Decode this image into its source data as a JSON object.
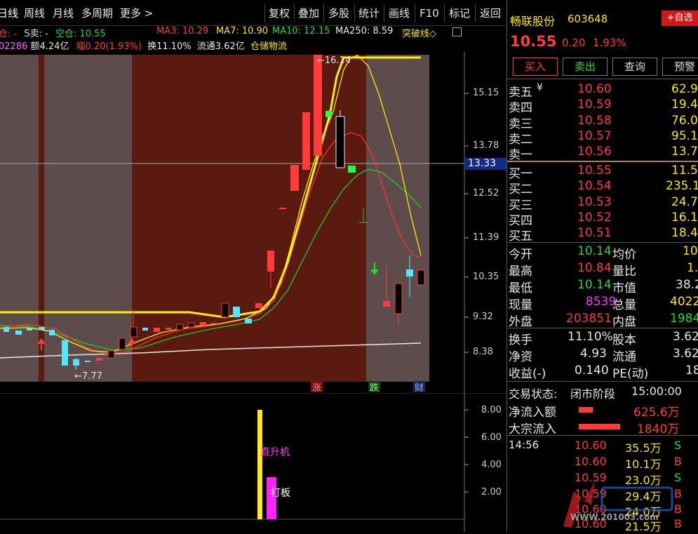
{
  "toolbar": {
    "left_tabs": [
      "日线",
      "周线",
      "月线",
      "多周期",
      "更多 >"
    ],
    "right_buttons": [
      "复权",
      "叠加",
      "多股",
      "统计",
      "画线",
      "F10",
      "标记",
      "返回"
    ]
  },
  "indicators": {
    "line1": {
      "prefix": "仓: -",
      "s_sell": "S卖: -",
      "empty_pos": "空仓: 10.55",
      "ma3": "MA3: 10.29",
      "ma7": "MA7: 10.90",
      "ma10": "MA10: 12.15",
      "ma250": "MA250: 8.59",
      "breakout": "突破线◇"
    },
    "line2": {
      "vol": "02286",
      "amount": "额4.24亿",
      "range": "幅0.20(1.93%)",
      "turnover": "换11.10%",
      "float": "流通3.62亿",
      "sector": "仓储物流"
    }
  },
  "chart": {
    "price_axis": [
      "15.15",
      "13.78",
      "12.52",
      "11.39",
      "10.35",
      "9.32",
      "8.38"
    ],
    "crosshair_value": "13.33",
    "high_label": "16.14",
    "low_label": "7.77",
    "event_markers": [
      "涨",
      "跌",
      "财"
    ],
    "sub_axis": [
      "8.00",
      "6.00",
      "4.00",
      "2.00"
    ],
    "sub_labels": [
      "直升机",
      "打板"
    ],
    "colors": {
      "up": "#ff3b3b",
      "down": "#55e6ff",
      "ma3": "#ffffff",
      "ma7": "#ffff00",
      "ma10": "#ff3333",
      "ma250": "#33cc33"
    }
  },
  "quote": {
    "name": "畅联股份",
    "code": "603648",
    "watch_btn": "+自选",
    "price": "10.55",
    "change": "0.20",
    "change_pct": "1.93%",
    "actions": [
      "买入",
      "卖出",
      "查询",
      "预警"
    ]
  },
  "order_book": {
    "asks": [
      {
        "label": "卖五",
        "price": "10.60",
        "vol": "62.9"
      },
      {
        "label": "卖四",
        "price": "10.59",
        "vol": "19.4"
      },
      {
        "label": "卖三",
        "price": "10.58",
        "vol": "76.0"
      },
      {
        "label": "卖二",
        "price": "10.57",
        "vol": "95.1"
      },
      {
        "label": "卖一",
        "price": "10.56",
        "vol": "13.7"
      }
    ],
    "bids": [
      {
        "label": "买一",
        "price": "10.55",
        "vol": "11.5"
      },
      {
        "label": "买二",
        "price": "10.54",
        "vol": "235.1"
      },
      {
        "label": "买三",
        "price": "10.53",
        "vol": "24.7"
      },
      {
        "label": "买四",
        "price": "10.52",
        "vol": "16.1"
      },
      {
        "label": "买五",
        "price": "10.51",
        "vol": "18.4"
      }
    ],
    "yen_mark": "¥"
  },
  "stats": [
    {
      "l1": "今开",
      "v1": "10.14",
      "l2": "均价",
      "v2": "10."
    },
    {
      "l1": "最高",
      "v1": "10.84",
      "l2": "量比",
      "v2": "1."
    },
    {
      "l1": "最低",
      "v1": "10.14",
      "l2": "市值",
      "v2": "38.2"
    },
    {
      "l1": "现量",
      "v1": "8539",
      "l2": "总量",
      "v2": "4022"
    },
    {
      "l1": "外盘",
      "v1": "203851",
      "l2": "内盘",
      "v2": "1984"
    }
  ],
  "fundamentals": [
    {
      "l1": "换手",
      "v1": "11.10%",
      "l2": "股本",
      "v2": "3.62"
    },
    {
      "l1": "净资",
      "v1": "4.93",
      "l2": "流通",
      "v2": "3.62"
    },
    {
      "l1": "收益(-)",
      "v1": "0.140",
      "l2": "PE(动)",
      "v2": "18"
    }
  ],
  "status": {
    "label": "交易状态:",
    "phase": "闭市阶段",
    "time": "15:00:00"
  },
  "flows": [
    {
      "label": "净流入额",
      "value": "625.6万",
      "bar": 0.15
    },
    {
      "label": "大宗流入",
      "value": "1840万",
      "bar": 0.45
    }
  ],
  "trades": [
    {
      "time": "14:56",
      "price": "10.60",
      "vol": "35.5万",
      "side": "S"
    },
    {
      "time": "",
      "price": "10.60",
      "vol": "10.1万",
      "side": "B"
    },
    {
      "time": "",
      "price": "10.59",
      "vol": "23.0万",
      "side": "S"
    },
    {
      "time": "",
      "price": "10.59",
      "vol": "29.4万",
      "side": "B"
    },
    {
      "time": "",
      "price": "10.60",
      "vol": "24.0万",
      "side": "B"
    },
    {
      "time": "",
      "price": "10.60",
      "vol": "21.5万",
      "side": "B"
    }
  ],
  "watermark": {
    "text": "WWW.201003.com"
  }
}
